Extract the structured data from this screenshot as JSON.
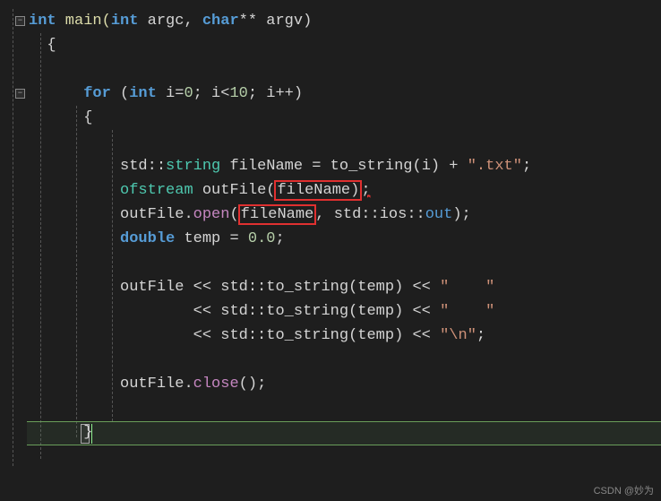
{
  "watermark": "CSDN @妙为",
  "code_lines": {
    "l1_int": "int",
    "l1_main": " main(",
    "l1_int2": "int",
    "l1_argc": " argc, ",
    "l1_char": "char",
    "l1_argv": "** argv)",
    "l2": "{",
    "l4_for": "for",
    "l4_paren": " (",
    "l4_int": "int",
    "l4_ieq": " i=",
    "l4_zero": "0",
    "l4_semi1": "; i<",
    "l4_ten": "10",
    "l4_semi2": "; i++)",
    "l5": "{",
    "l7_std": "std::",
    "l7_string": "string",
    "l7_fname": " fileName = to_string(i) + ",
    "l7_txt": "\".txt\"",
    "l7_end": ";",
    "l8_ofs": "ofstream",
    "l8_outfile": " outFile(",
    "l8_fname": "fileName",
    "l8_paren": ")",
    "l8_semi": ";",
    "l9_outfile": "outFile.",
    "l9_open": "open",
    "l9_paren1": "(",
    "l9_fname": "fileName",
    "l9_comma": ", std::ios::",
    "l9_out": "out",
    "l9_end": ");",
    "l10_double": "double",
    "l10_temp": " temp = ",
    "l10_val": "0.0",
    "l10_end": ";",
    "l12_out": "outFile << std::to_string(temp) << ",
    "l12_str": "\"    \"",
    "l13_out": "        << std::to_string(temp) << ",
    "l13_str": "\"    \"",
    "l14_out": "        << std::to_string(temp) << ",
    "l14_str": "\"\\n\"",
    "l14_end": ";",
    "l16_out": "outFile.",
    "l16_close": "close",
    "l16_end": "();",
    "l17": "}"
  }
}
